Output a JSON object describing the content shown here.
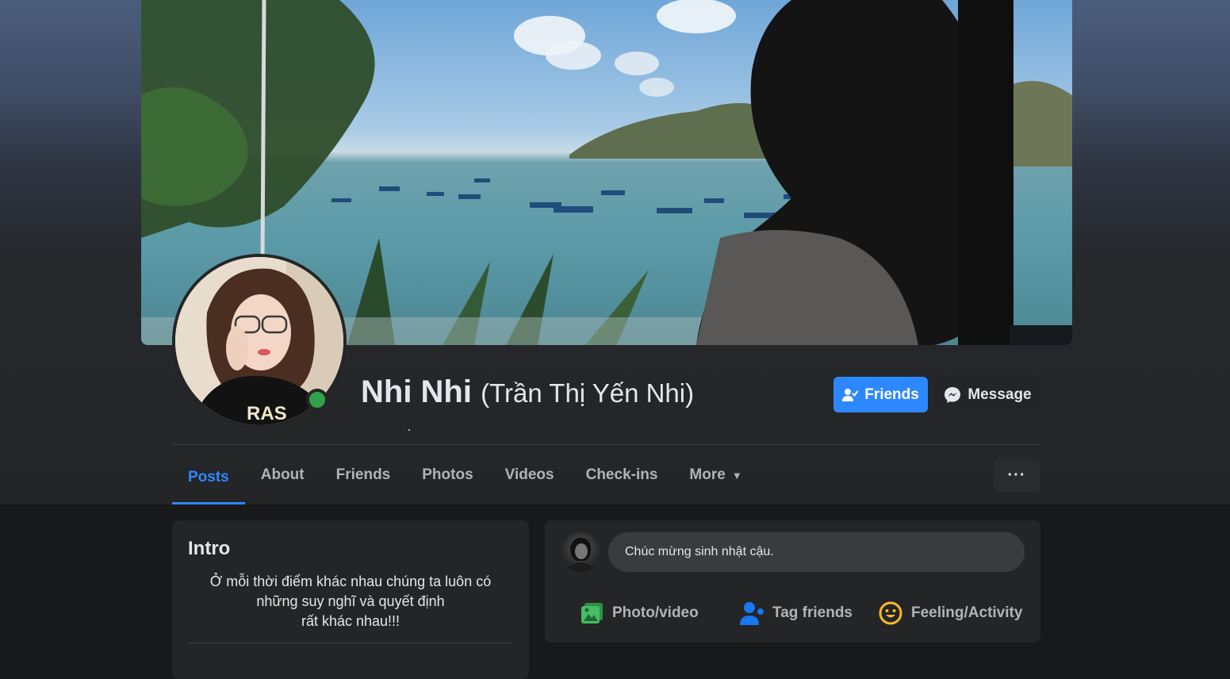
{
  "profile": {
    "name": "Nhi Nhi",
    "alt_name": "(Trần Thị Yến Nhi)",
    "friends_button": "Friends",
    "message_button": "Message",
    "more_options": "···"
  },
  "tabs": [
    {
      "label": "Posts",
      "active": true
    },
    {
      "label": "About"
    },
    {
      "label": "Friends"
    },
    {
      "label": "Photos"
    },
    {
      "label": "Videos"
    },
    {
      "label": "Check-ins"
    },
    {
      "label": "More",
      "caret": "▼"
    }
  ],
  "intro": {
    "title": "Intro",
    "bio_line1": "Ở mỗi thời điểm khác nhau chúng ta luôn có",
    "bio_line2": "những suy nghĩ và quyết định",
    "bio_line3": "rất khác nhau!!!"
  },
  "composer": {
    "input_text": "Chúc mừng sinh nhật cậu.",
    "photo_video": "Photo/video",
    "tag_friends": "Tag friends",
    "feeling_activity": "Feeling/Activity"
  },
  "colors": {
    "accent": "#2d88ff",
    "online": "#31a24c",
    "photo_icon": "#45bd62",
    "tag_icon": "#1877f2",
    "feeling_icon": "#f7b928"
  },
  "icons": {
    "friends": "person-check-icon",
    "message": "messenger-icon",
    "photo": "photo-icon",
    "tag": "tag-friends-icon",
    "feeling": "smiley-icon",
    "more": "ellipsis-icon",
    "caret": "caret-down-icon"
  }
}
